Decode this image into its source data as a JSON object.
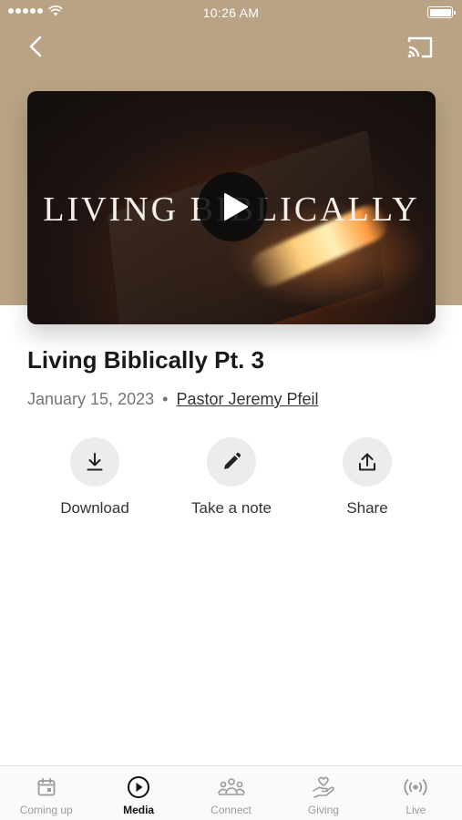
{
  "status_bar": {
    "time": "10:26 AM"
  },
  "video": {
    "poster_title": "LIVING BIBLICALLY"
  },
  "sermon": {
    "title": "Living Biblically Pt. 3",
    "date": "January 15, 2023",
    "separator": "•",
    "speaker": "Pastor Jeremy Pfeil"
  },
  "actions": [
    {
      "label": "Download",
      "icon": "download-icon"
    },
    {
      "label": "Take a note",
      "icon": "pencil-icon"
    },
    {
      "label": "Share",
      "icon": "share-icon"
    }
  ],
  "tabs": [
    {
      "label": "Coming up",
      "icon": "calendar-icon",
      "active": false
    },
    {
      "label": "Media",
      "icon": "play-circle-icon",
      "active": true
    },
    {
      "label": "Connect",
      "icon": "people-icon",
      "active": false
    },
    {
      "label": "Giving",
      "icon": "giving-hand-icon",
      "active": false
    },
    {
      "label": "Live",
      "icon": "broadcast-icon",
      "active": false
    }
  ],
  "colors": {
    "hero_background": "#b9a384",
    "active_tab": "#111111",
    "inactive_tab": "#9a9a9a",
    "action_circle": "#ececec"
  }
}
